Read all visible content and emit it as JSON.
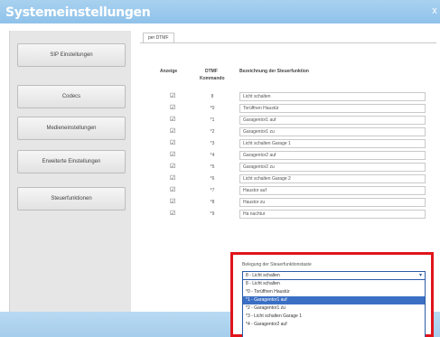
{
  "window": {
    "title": "Systemeinstellungen",
    "close_glyph": "x"
  },
  "sidebar": {
    "items": [
      {
        "label": "SIP Einstellungen"
      },
      {
        "label": "Codecs"
      },
      {
        "label": "Medieneinstellungen"
      },
      {
        "label": "Erweiterte Einstellungen"
      },
      {
        "label": "Steuerfunktionen"
      }
    ]
  },
  "tabs": [
    {
      "label": "per DTMF",
      "active": true
    }
  ],
  "table": {
    "headers": {
      "display": "Anzeige",
      "dtmf_line1": "DTMF",
      "dtmf_line2": "Kommando",
      "description": "Bezeichnung der Steuerfunktion"
    },
    "rows": [
      {
        "checked": true,
        "command": "8",
        "label": "Licht schalten"
      },
      {
        "checked": true,
        "command": "*0",
        "label": "Torüffnen Haustür"
      },
      {
        "checked": true,
        "command": "*1",
        "label": "Garagentor1 auf"
      },
      {
        "checked": true,
        "command": "*2",
        "label": "Garagentor1 zu"
      },
      {
        "checked": true,
        "command": "*3",
        "label": "Licht schalten Garage 1"
      },
      {
        "checked": true,
        "command": "*4",
        "label": "Garagentor2 auf"
      },
      {
        "checked": true,
        "command": "*5",
        "label": "Garagentor2 zu"
      },
      {
        "checked": true,
        "command": "*6",
        "label": "Licht schalten Garage 2"
      },
      {
        "checked": true,
        "command": "*7",
        "label": "Haustor auf"
      },
      {
        "checked": true,
        "command": "*8",
        "label": "Haustor zu"
      },
      {
        "checked": true,
        "command": "*9",
        "label": "Ha nachtur"
      }
    ]
  },
  "dropdown": {
    "label": "Belegung der Steuerfunktionstaste",
    "selected_value": "8 - Licht schalten",
    "options": [
      {
        "label": "8 - Licht schalten",
        "selected": false
      },
      {
        "label": "*0 - Torüffnen Haustür",
        "selected": false
      },
      {
        "label": "*1 - Garagentor1 auf",
        "selected": true
      },
      {
        "label": "*2 - Garagentor1 zu",
        "selected": false
      },
      {
        "label": "*3 - Licht schalten Garage 1",
        "selected": false
      },
      {
        "label": "*4 - Garagentor2 auf",
        "selected": false
      }
    ]
  },
  "colors": {
    "titlebar": "#8fc2ea",
    "highlight_border": "#e0141b",
    "selection": "#3a6fc4"
  }
}
